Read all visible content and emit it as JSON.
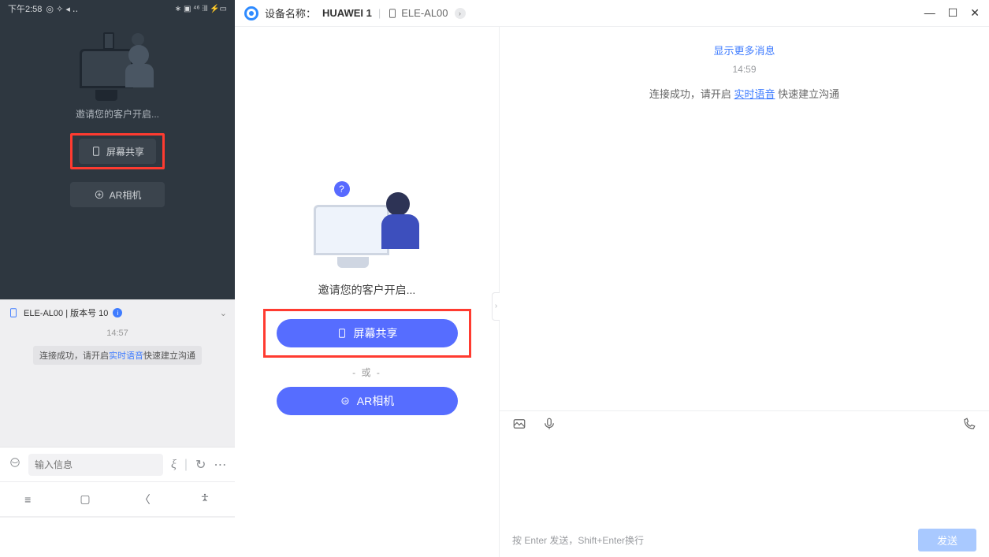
{
  "phone": {
    "time": "下午2:58",
    "status_icons": "◎ ✧ ◂ ‥",
    "right_icons": "∗ ▣ ⁴⁶ ⫶ll ⚡▭",
    "invite_text": "邀请您的客户开启...",
    "screen_share": "屏幕共享",
    "ar_camera": "AR相机",
    "chat_title": "ELE-AL00 | 版本号 10",
    "chat_time": "14:57",
    "chat_msg_pre": "连接成功，请开启",
    "chat_msg_link": "实时语音",
    "chat_msg_post": "快速建立沟通",
    "input_placeholder": "输入信息"
  },
  "topbar": {
    "label": "设备名称：",
    "name": "HUAWEI 1",
    "model": "ELE-AL00"
  },
  "center": {
    "invite": "邀请您的客户开启...",
    "screen_share": "屏幕共享",
    "or": "- 或 -",
    "ar_camera": "AR相机"
  },
  "right": {
    "more": "显示更多消息",
    "time": "14:59",
    "line_pre": "连接成功，请开启 ",
    "line_link": "实时语音",
    "line_post": " 快速建立沟通",
    "hint": "按 Enter 发送，Shift+Enter换行",
    "send": "发送"
  }
}
